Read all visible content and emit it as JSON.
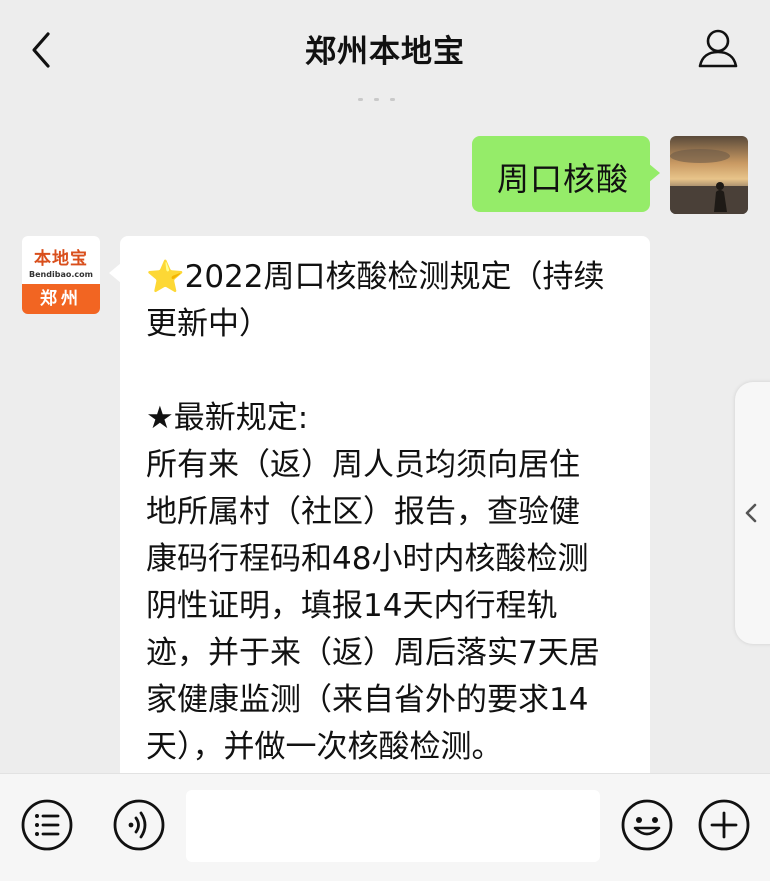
{
  "header": {
    "title": "郑州本地宝"
  },
  "messages": {
    "outgoing": {
      "text": "周口核酸"
    },
    "incoming": {
      "bot_logo": {
        "name": "本地宝",
        "domain": "Bendibao.com",
        "city": "郑州"
      },
      "title_emoji": "⭐",
      "title_line1": "2022周口核酸检测规定（持续",
      "title_line2": "更新中）",
      "section_heading": "★最新规定:",
      "body_lines": [
        "所有来（返）周人员均须向居住",
        "地所属村（社区）报告，查验健",
        "康码行程码和48小时内核酸检测",
        "阴性证明，填报14天内行程轨",
        "迹，并于来（返）周后落实7天居",
        "家健康监测（来自省外的要求14",
        "天），并做一次核酸检测。"
      ]
    }
  },
  "input": {
    "value": ""
  },
  "colors": {
    "outgoing_bubble": "#95ec69",
    "background": "#ededed",
    "logo_orange": "#f26522"
  },
  "icons": {
    "back": "chevron-left-icon",
    "profile": "person-icon",
    "menu": "list-icon",
    "voice": "voice-icon",
    "emoji": "smiley-icon",
    "add": "plus-icon",
    "side": "chevron-left-icon"
  }
}
